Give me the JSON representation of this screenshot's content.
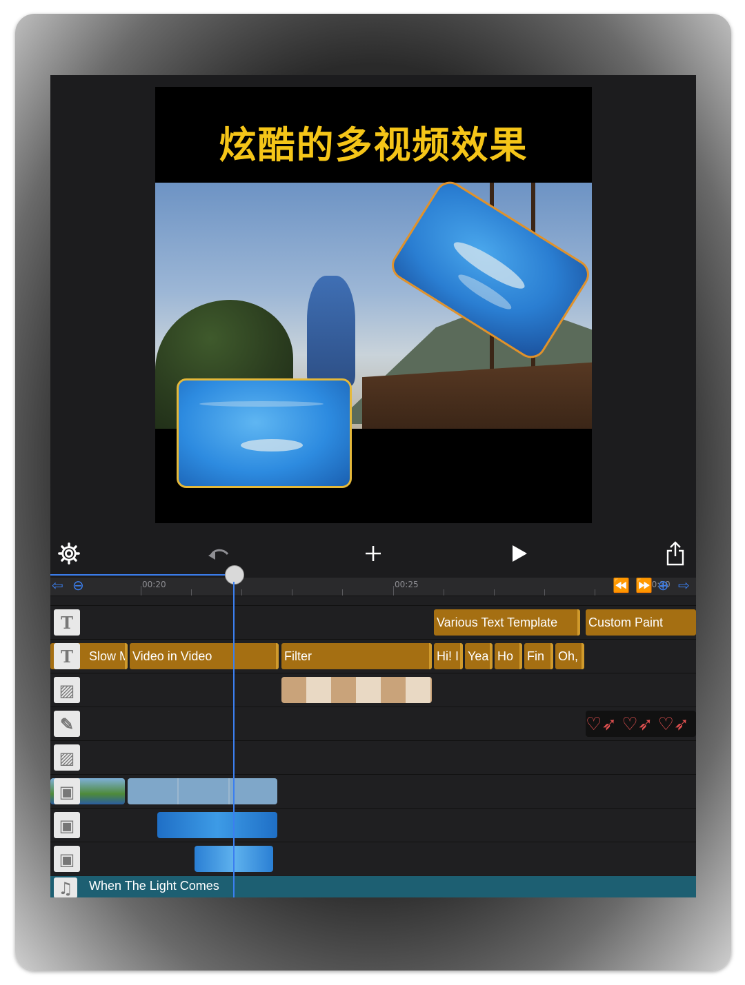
{
  "preview": {
    "title": "炫酷的多视频效果"
  },
  "toolbar": {
    "settings_icon": "gear-icon",
    "undo_icon": "undo-icon",
    "add_icon": "plus-icon",
    "play_icon": "play-icon",
    "share_icon": "share-icon"
  },
  "ruler": {
    "time_1": "00:20",
    "time_2": "00:25",
    "time_3": "00:30"
  },
  "tracks": {
    "text_track_1": {
      "clips": [
        "Various Text Template",
        "Custom Paint"
      ]
    },
    "text_track_2": {
      "clips": [
        "Slow M",
        "Video in Video",
        "Filter",
        "Hi! I",
        "Yea",
        "Ho",
        "Fin",
        "Oh,"
      ]
    },
    "audio": {
      "title": "When The Light Comes"
    }
  },
  "colors": {
    "accent_blue": "#3b7ff0",
    "clip_gold": "#a56f12",
    "title_yellow": "#f5c518",
    "audio_teal": "#1d5f72"
  }
}
